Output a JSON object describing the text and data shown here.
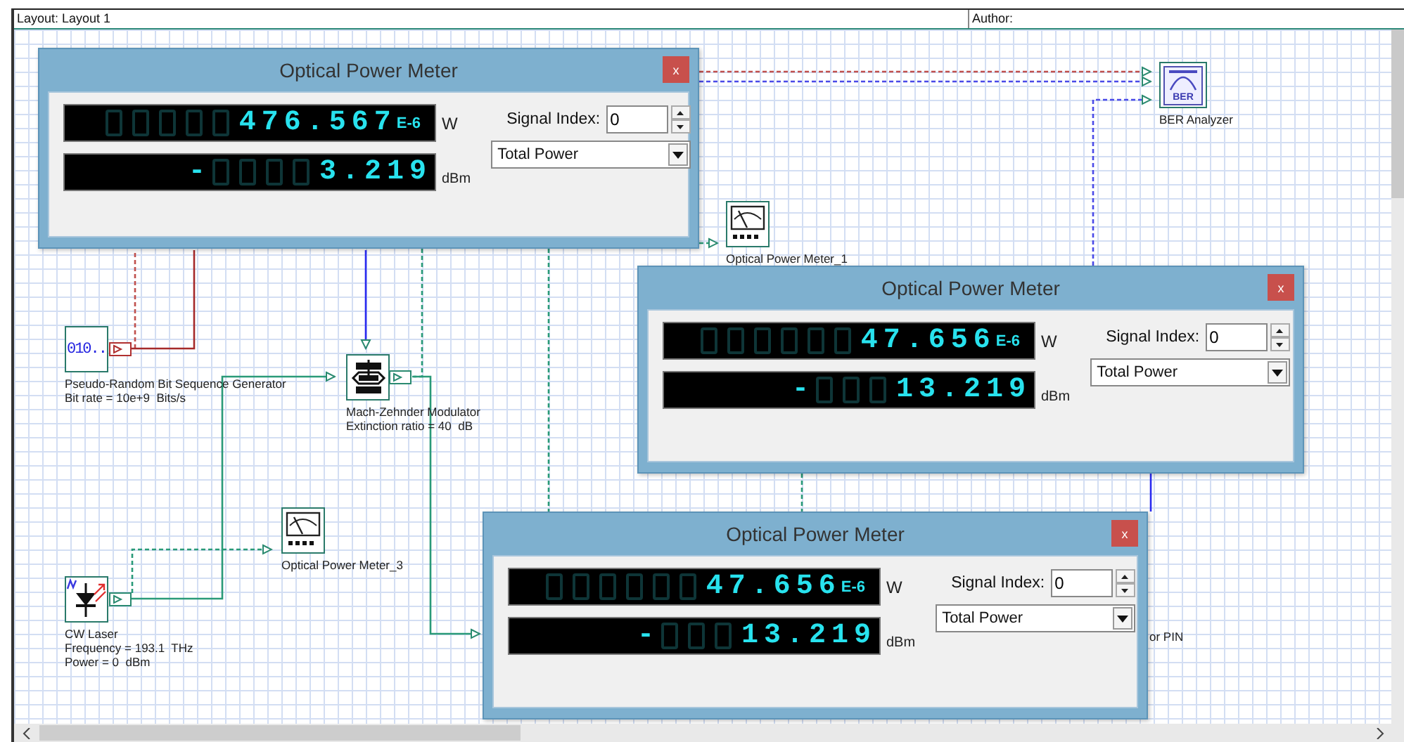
{
  "layout_bar": {
    "layout": "Layout: Layout 1",
    "author": "Author:"
  },
  "components": [
    {
      "kind": "prbs",
      "icon_text": "010..",
      "labels": [
        "Pseudo-Random Bit Sequence Generator",
        "Bit rate = 10e+9  Bits/s"
      ]
    },
    {
      "kind": "modulator",
      "labels": [
        "Mach-Zehnder Modulator",
        "Extinction ratio = 40  dB"
      ]
    },
    {
      "kind": "laser",
      "labels": [
        "CW Laser",
        "Frequency = 193.1  THz",
        "Power = 0  dBm"
      ]
    },
    {
      "kind": "meter",
      "labels": [
        "Optical Power Meter_3"
      ]
    },
    {
      "kind": "meter",
      "labels": [
        "Optical Power Meter_1"
      ]
    },
    {
      "kind": "ber",
      "icon_text": "BER",
      "labels": [
        "BER Analyzer"
      ]
    },
    {
      "kind": "hidden",
      "labels": [
        "or PIN"
      ]
    }
  ],
  "meter_windows": [
    {
      "title": "Optical Power Meter",
      "close": "x",
      "power": "476.567",
      "exponent": "E-6",
      "power_unit": "W",
      "dbm_sign": "-",
      "dbm_value": "3.219",
      "dbm_unit": "dBm",
      "signal_index_label": "Signal Index:",
      "signal_index": "0",
      "mode": "Total Power"
    },
    {
      "title": "Optical Power Meter",
      "close": "x",
      "power": "47.656",
      "exponent": "E-6",
      "power_unit": "W",
      "dbm_sign": "-",
      "dbm_value": "13.219",
      "dbm_unit": "dBm",
      "signal_index_label": "Signal Index:",
      "signal_index": "0",
      "mode": "Total Power"
    },
    {
      "title": "Optical Power Meter",
      "close": "x",
      "power": "47.656",
      "exponent": "E-6",
      "power_unit": "W",
      "dbm_sign": "-",
      "dbm_value": "13.219",
      "dbm_unit": "dBm",
      "signal_index_label": "Signal Index:",
      "signal_index": "0",
      "mode": "Total Power"
    }
  ]
}
